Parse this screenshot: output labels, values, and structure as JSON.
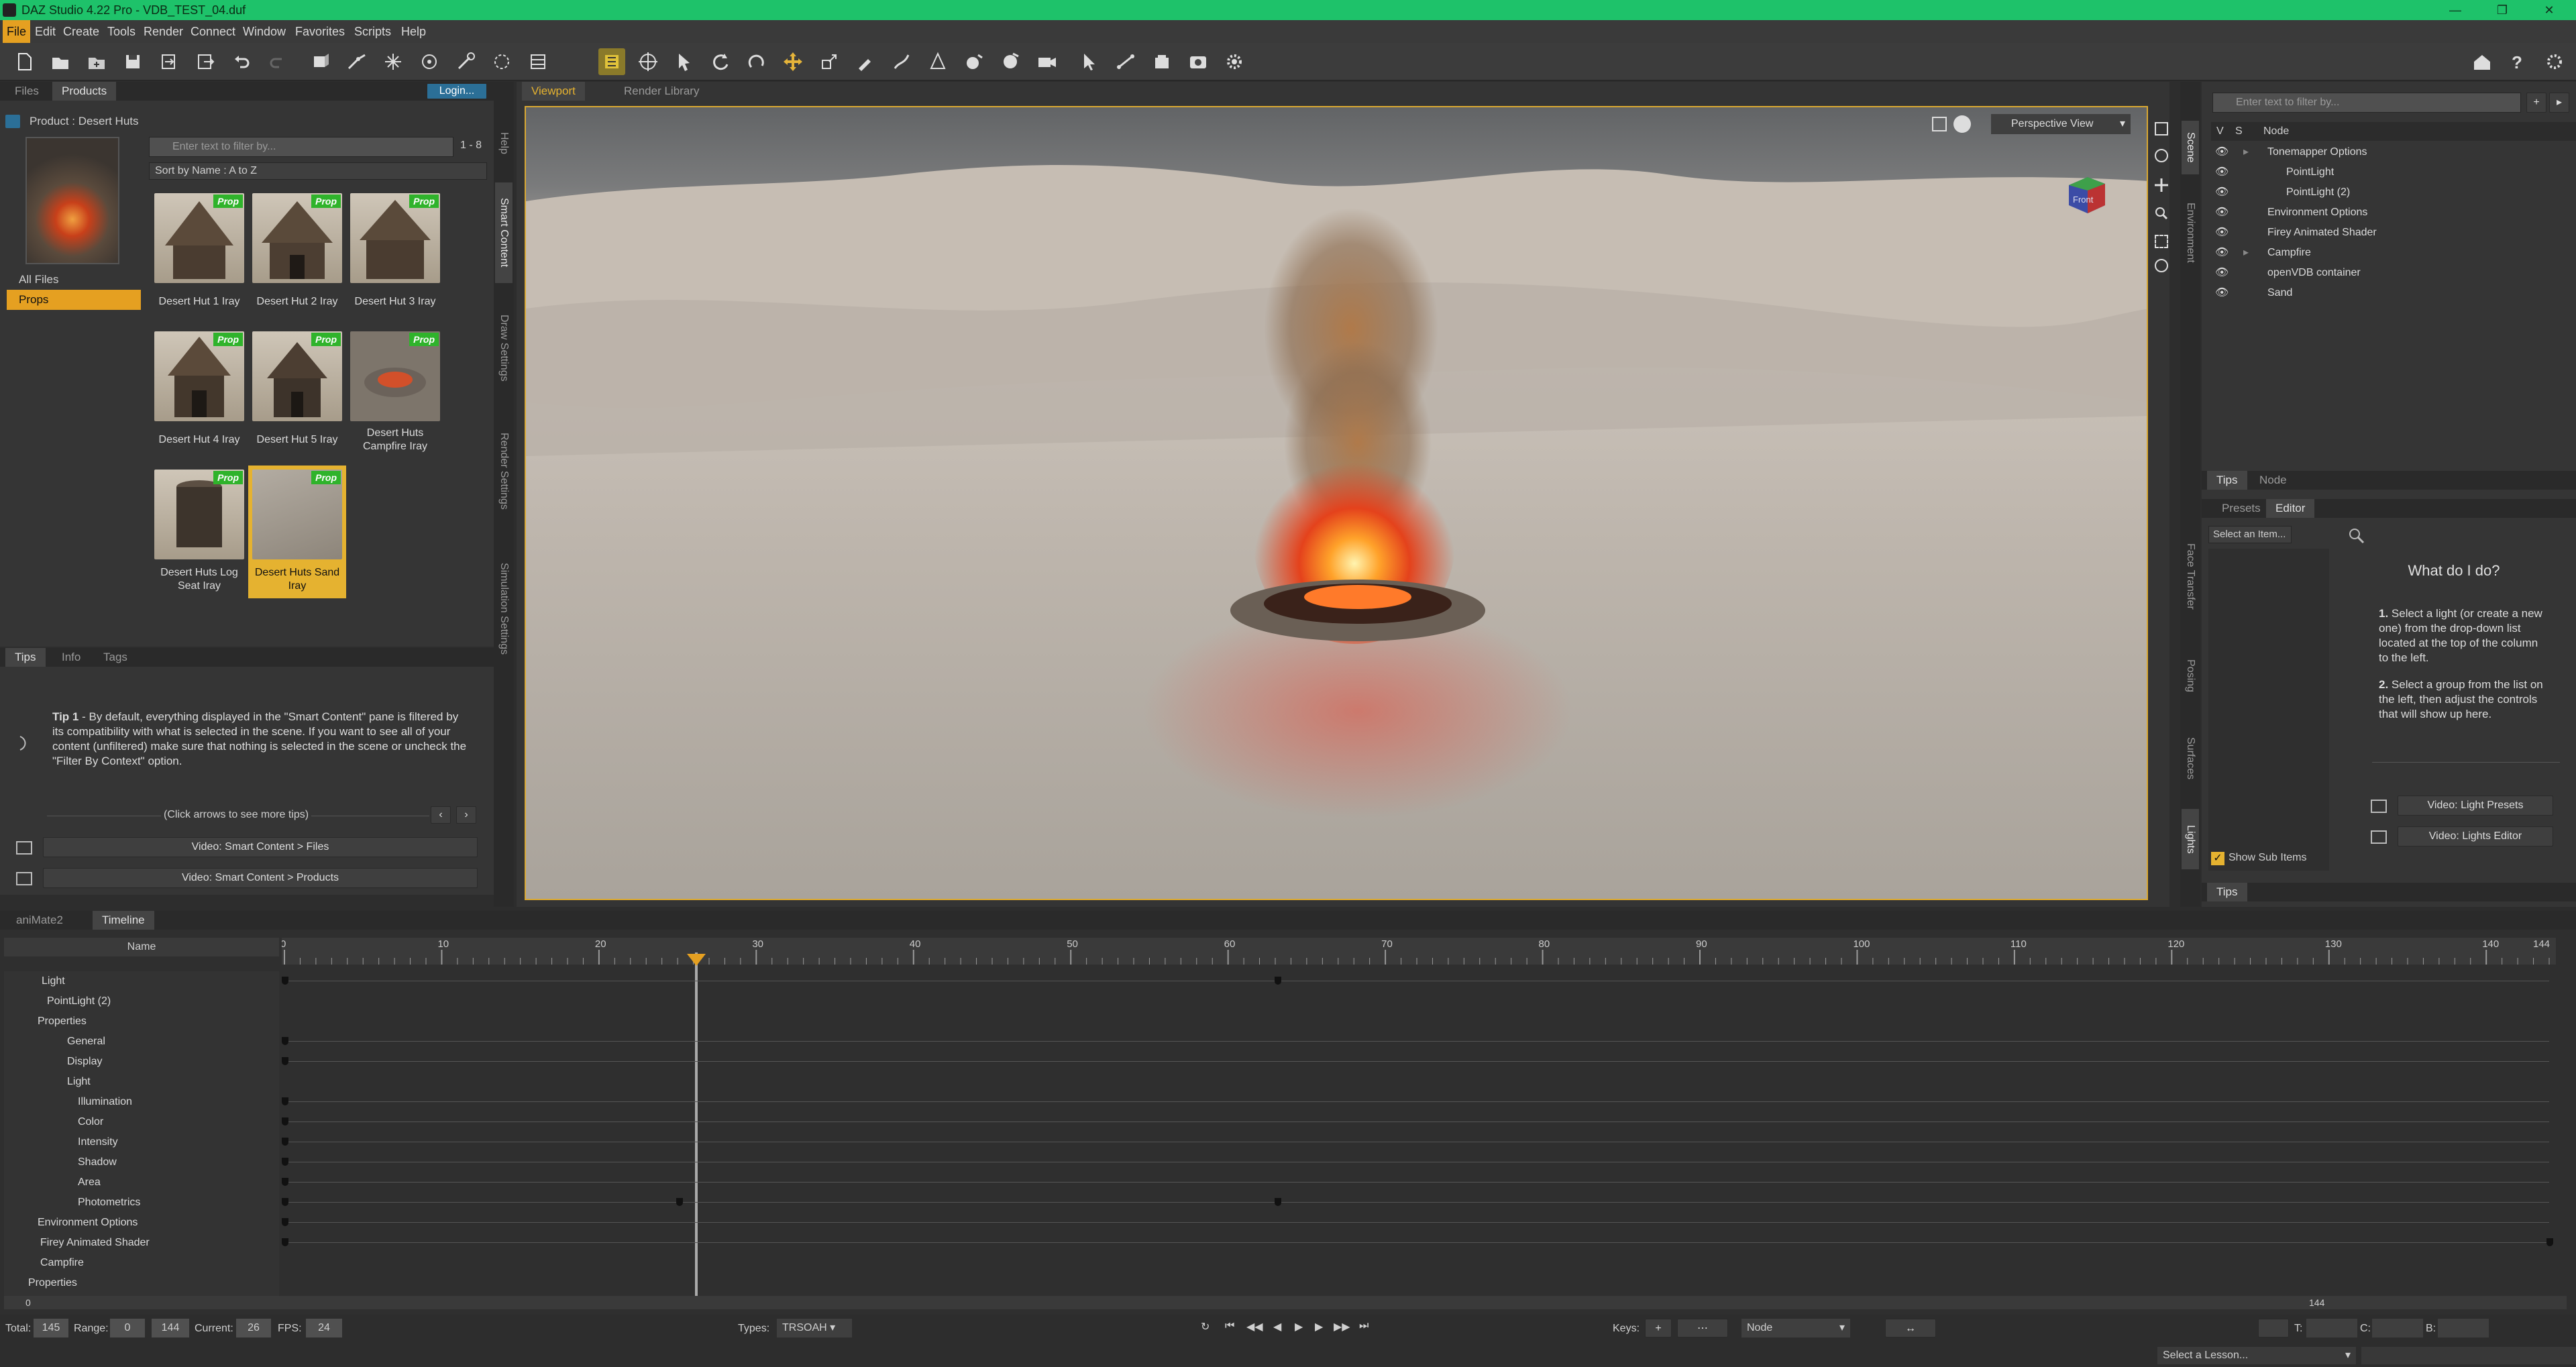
{
  "app": {
    "title": "DAZ Studio 4.22 Pro - VDB_TEST_04.duf"
  },
  "menu": [
    "File",
    "Edit",
    "Create",
    "Tools",
    "Render",
    "Connect",
    "Window",
    "Favorites",
    "Scripts",
    "Help"
  ],
  "left": {
    "tabs": [
      "Files",
      "Products"
    ],
    "login": "Login...",
    "breadcrumb": "Product : Desert Huts",
    "folders": [
      "All Files",
      "Props"
    ],
    "filter_placeholder": "Enter text to filter by...",
    "count": "1 - 8",
    "sort": "Sort by Name : A to Z",
    "badge": "Prop",
    "items": [
      "Desert Hut 1 Iray",
      "Desert Hut 2 Iray",
      "Desert Hut 3 Iray",
      "Desert Hut 4 Iray",
      "Desert Hut 5 Iray",
      "Desert Huts Campfire Iray",
      "Desert Huts Log Seat Iray",
      "Desert Huts Sand Iray"
    ],
    "vtabs": [
      "Help",
      "Smart Content",
      "Draw Settings",
      "Render Settings",
      "Simulation Settings"
    ]
  },
  "tips": {
    "tabs": [
      "Tips",
      "Info",
      "Tags"
    ],
    "title": "Tip 1",
    "body": " - By default, everything displayed in the \"Smart Content\" pane is filtered by its compatibility with what is selected in the scene. If you want to see all of your content (unfiltered) make sure that nothing is selected in the scene or uncheck the \"Filter By Context\" option.",
    "more": "(Click arrows to see more tips)",
    "video1": "Video: Smart Content > Files",
    "video2": "Video: Smart Content > Products"
  },
  "viewport": {
    "tabs": [
      "Viewport",
      "Render Library"
    ],
    "view": "Perspective View",
    "cube": "Front"
  },
  "scene": {
    "filter_placeholder": "Enter text to filter by...",
    "headers": [
      "V",
      "S",
      "Node"
    ],
    "nodes": [
      "Tonemapper Options",
      "PointLight",
      "PointLight (2)",
      "Environment Options",
      "Firey Animated Shader",
      "Campfire",
      "openVDB container",
      "Sand"
    ],
    "vtabs": [
      "Scene",
      "Environment"
    ]
  },
  "lights": {
    "tabs": [
      "Tips",
      "Node"
    ],
    "subtabs": [
      "Presets",
      "Editor"
    ],
    "select": "Select an Item...",
    "what": "What do I do?",
    "s1n": "1.",
    "s1": " Select a light (or create a new one) from the drop-down list located at the top of the column to the left.",
    "s2n": "2.",
    "s2": " Select a group from the list on the left, then adjust the controls that will show up here.",
    "v1": "Video: Light Presets",
    "v2": "Video: Lights Editor",
    "showsub": "Show Sub Items",
    "bottom": "Tips",
    "vtabs": [
      "Face Transfer",
      "Posing",
      "Surfaces",
      "Lights"
    ]
  },
  "timeline": {
    "tabs": [
      "aniMate2",
      "Timeline"
    ],
    "name_header": "Name",
    "ticks": [
      "0",
      "10",
      "20",
      "30",
      "40",
      "50",
      "60",
      "70",
      "80",
      "90",
      "100",
      "110",
      "120",
      "130",
      "140",
      "144"
    ],
    "rows": [
      "Light",
      "PointLight (2)",
      "Properties",
      "General",
      "Display",
      "Light",
      "Illumination",
      "Color",
      "Intensity",
      "Shadow",
      "Area",
      "Photometrics",
      "Environment Options",
      "Firey Animated Shader",
      "Campfire",
      "Properties"
    ],
    "scroll_start": "0",
    "scroll_end": "144",
    "total_label": "Total:",
    "total": "145",
    "range_label": "Range:",
    "range_start": "0",
    "range_end": "144",
    "current_label": "Current:",
    "current": "26",
    "fps_label": "FPS:",
    "fps": "24",
    "types_label": "Types:",
    "types": "TRSOAH",
    "keys_label": "Keys:",
    "node": "Node",
    "t_label": "T:",
    "c_label": "C:",
    "b_label": "B:",
    "lesson": "Select a Lesson..."
  }
}
